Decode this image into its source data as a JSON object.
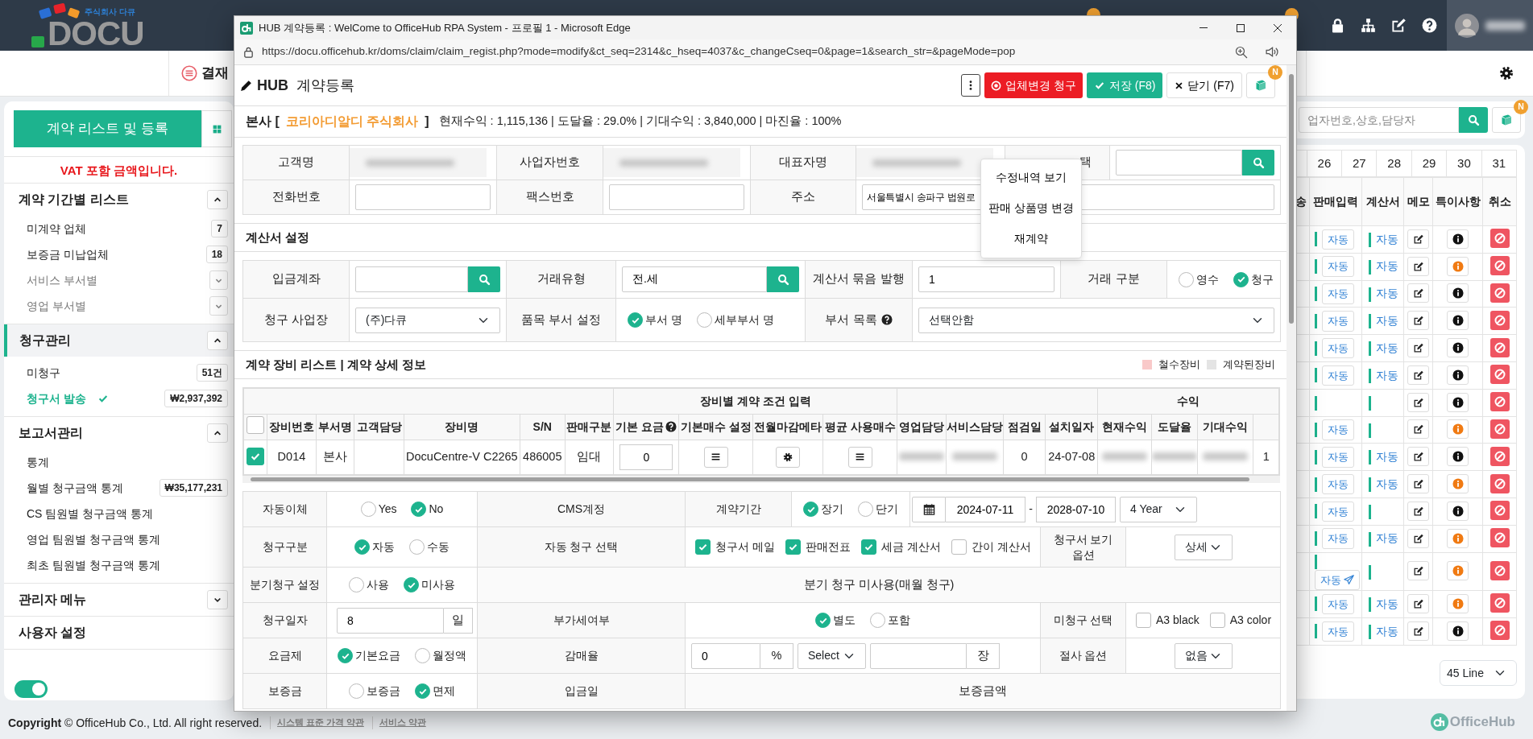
{
  "header": {
    "logo_tagline": "주식회사 다큐",
    "logo_text": "DOCU"
  },
  "subnav": {
    "item": "결재"
  },
  "sidebar": {
    "primary_button": "계약 리스트 및 등록",
    "notice": "VAT 포함 금액입니다.",
    "sections": [
      {
        "title": "계약 기간별 리스트",
        "kind": "collapsible",
        "expanded": true,
        "selected": false,
        "items": [
          {
            "label": "미계약 업체",
            "kind": "count",
            "badge": "7",
            "selected": false
          },
          {
            "label": "보증금 미납업체",
            "kind": "count",
            "badge": "18",
            "selected": false
          },
          {
            "label": "서비스 부서별",
            "kind": "submenu",
            "expanded": false,
            "selected": false
          },
          {
            "label": "영업 부서별",
            "kind": "submenu",
            "expanded": false,
            "selected": false
          }
        ]
      },
      {
        "title": "청구관리",
        "kind": "collapsible",
        "expanded": true,
        "selected": true,
        "items": [
          {
            "label": "미청구",
            "kind": "count",
            "badge": "51건",
            "selected": false
          },
          {
            "label": "청구서 발송",
            "kind": "count",
            "badge": "₩2,937,392",
            "selected": true
          }
        ]
      },
      {
        "title": "보고서관리",
        "kind": "collapsible",
        "expanded": true,
        "selected": false,
        "items": [
          {
            "label": "통계",
            "kind": "link",
            "selected": false
          },
          {
            "label": "월별 청구금액 통계",
            "kind": "count",
            "badge": "₩35,177,231",
            "selected": false
          },
          {
            "label": "CS 팀원별 청구금액 통계",
            "kind": "link",
            "selected": false
          },
          {
            "label": "영업 팀원별 청구금액 통계",
            "kind": "link",
            "selected": false
          },
          {
            "label": "최초 팀원별 청구금액 통계",
            "kind": "link",
            "selected": false
          }
        ]
      },
      {
        "title": "관리자 메뉴",
        "kind": "collapsible",
        "expanded": false,
        "selected": false
      },
      {
        "title": "사용자 설정",
        "kind": "link",
        "selected": false
      }
    ],
    "toggle_on": true
  },
  "list_panel": {
    "search_placeholder": "업자번호,상호,담당자",
    "manual_badge": "N",
    "dates": [
      "26",
      "27",
      "28",
      "29",
      "30",
      "31"
    ],
    "columns": [
      "송",
      "판매입력",
      "계산서",
      "메모",
      "특이사항",
      "취소"
    ],
    "rows": [
      {
        "sales": "자동",
        "sales_sent": false,
        "invoice": "자동",
        "flagged": false
      },
      {
        "sales": "자동",
        "sales_sent": false,
        "invoice": "자동",
        "flagged": true
      },
      {
        "sales": "자동",
        "sales_sent": false,
        "invoice": "자동",
        "flagged": false
      },
      {
        "sales": "자동",
        "sales_sent": false,
        "invoice": "자동",
        "flagged": false
      },
      {
        "sales": "자동",
        "sales_sent": false,
        "invoice": "자동",
        "flagged": false
      },
      {
        "sales": "자동",
        "sales_sent": false,
        "invoice": "자동",
        "flagged": false
      },
      {
        "flagged": false
      },
      {
        "sales": "자동",
        "sales_sent": false,
        "flagged": true
      },
      {
        "sales": "자동",
        "sales_sent": false,
        "invoice": "자동",
        "flagged": false
      },
      {
        "sales": "자동",
        "sales_sent": false,
        "invoice": "자동",
        "flagged": true
      },
      {
        "sales": "자동",
        "sales_sent": false,
        "flagged": false
      },
      {
        "sales": "자동",
        "sales_sent": false,
        "invoice": "자동",
        "flagged": true
      },
      {
        "sales": "자동",
        "sales_sent": true,
        "flagged": true
      },
      {
        "sales": "자동",
        "sales_sent": false,
        "invoice": "자동",
        "flagged": true
      },
      {
        "sales": "자동",
        "sales_sent": false,
        "invoice": "자동",
        "flagged": false
      }
    ],
    "page_size": "45 Line"
  },
  "footer": {
    "copyright": "**Copyright** © OfficeHub Co., Ltd. All right reserved.",
    "links": [
      "시스템 표준 가격 약관",
      "서비스 약관"
    ],
    "brand": "OfficeHub"
  },
  "popup": {
    "title": "HUB 계약등록 : WelCome to OfficeHub RPA System - 프로필 1 - Microsoft Edge",
    "url": "https://docu.officehub.kr/doms/claim/claim_regist.php?mode=modify&ct_seq=2314&c_hseq=4037&c_changeCseq=0&page=1&search_str=&pageMode=pop",
    "brand": "HUB",
    "heading": "계약등록",
    "toolbar": [
      {
        "kind": "more"
      },
      {
        "kind": "danger",
        "label": "업체변경 청구"
      },
      {
        "kind": "save",
        "label": "저장 (F8)"
      },
      {
        "kind": "close",
        "label": "닫기 (F7)"
      },
      {
        "kind": "manual",
        "badge": "N"
      }
    ],
    "more_menu": {
      "open": true,
      "items": [
        "수정내역 보기",
        "판매 상품명 변경",
        "재계약"
      ]
    },
    "company": {
      "branch": "본사 [",
      "name": "코리아디알디 주식회사",
      "close": "]",
      "stats": "현재수익 : 1,115,136 | 도달율 : 29.0% | 기대수익 : 3,840,000 | 마진율 : 100%"
    },
    "customer_rows": [
      [
        {
          "label": "고객명",
          "kind": "redacted"
        },
        {
          "label": "사업자번호",
          "kind": "redacted"
        },
        {
          "label": "대표자명",
          "kind": "redacted"
        },
        {
          "label": "택",
          "kind": "search"
        }
      ],
      [
        {
          "label": "전화번호",
          "kind": "input"
        },
        {
          "label": "팩스번호",
          "kind": "input"
        },
        {
          "label": "주소",
          "kind": "input",
          "value": "서울특별시 송파구 법원로"
        }
      ]
    ],
    "invoice_title": "계산서 설정",
    "invoice_rows": [
      [
        {
          "label": "입금계좌",
          "kind": "search"
        },
        {
          "label": "거래유형",
          "kind": "search",
          "value": "전.세"
        },
        {
          "label": "계산서 묶음 발행",
          "kind": "input",
          "value": "1"
        },
        {
          "label": "거래 구분",
          "kind": "radio",
          "options": [
            {
              "label": "영수",
              "selected": false
            },
            {
              "label": "청구",
              "selected": true
            }
          ]
        }
      ],
      [
        {
          "label": "청구 사업장",
          "kind": "select",
          "value": "(주)다큐"
        },
        {
          "label": "품목 부서 설정",
          "kind": "radio",
          "options": [
            {
              "label": "부서 명",
              "selected": true
            },
            {
              "label": "세부부서 명",
              "selected": false
            }
          ]
        },
        {
          "label": "부서 목록",
          "kind": "select",
          "help": true,
          "value": "선택안함"
        }
      ]
    ],
    "equipment_title": "계약 장비 리스트 | 계약 상세 정보",
    "legend": [
      {
        "label": "철수장비",
        "color": "#f9c9c9"
      },
      {
        "label": "계약된장비",
        "color": "#e4e4e4"
      }
    ],
    "column_groups": [
      {
        "label": "장비별 계약 조건 입력"
      },
      {
        "label": "수익"
      }
    ],
    "columns": [
      {
        "kind": "checkbox",
        "checked": false
      },
      {
        "label": "장비번호"
      },
      {
        "label": "부서명"
      },
      {
        "label": "고객담당"
      },
      {
        "label": "장비명"
      },
      {
        "label": "S/N"
      },
      {
        "label": "판매구분"
      },
      {
        "label": "기본 요금",
        "help": true
      },
      {
        "label": "기본매수 설정"
      },
      {
        "label": "전월마감메타"
      },
      {
        "label": "평균 사용매수"
      },
      {
        "label": "영업담당"
      },
      {
        "label": "서비스담당"
      },
      {
        "label": "점검일"
      },
      {
        "label": "설치일자"
      },
      {
        "label": "현재수익"
      },
      {
        "label": "도달율"
      },
      {
        "label": "기대수익"
      },
      {}
    ],
    "equipment_rows": [
      {
        "checked": true,
        "cells": [
          {
            "kind": "text",
            "value": "D014"
          },
          {
            "kind": "text",
            "value": "본사"
          },
          {
            "kind": "empty"
          },
          {
            "kind": "text",
            "value": "DocuCentre-V C2265"
          },
          {
            "kind": "text",
            "value": "486005"
          },
          {
            "kind": "text",
            "value": "임대"
          },
          {
            "kind": "input",
            "value": "0"
          },
          {
            "kind": "list_button"
          },
          {
            "kind": "gear_button"
          },
          {
            "kind": "list_button"
          },
          {
            "kind": "redacted"
          },
          {
            "kind": "redacted"
          },
          {
            "kind": "text",
            "value": "0"
          },
          {
            "kind": "text",
            "value": "24-07-08"
          },
          {
            "kind": "redacted"
          },
          {
            "kind": "redacted"
          },
          {
            "kind": "redacted"
          },
          {
            "kind": "text",
            "value": "1"
          }
        ]
      }
    ],
    "detail_rows": [
      [
        {
          "kind": "label",
          "text": "자동이체"
        },
        {
          "kind": "radio",
          "options": [
            {
              "label": "Yes",
              "selected": false
            },
            {
              "label": "No",
              "selected": true
            }
          ]
        },
        {
          "kind": "label",
          "text": "CMS계정"
        },
        {
          "kind": "label",
          "text": "계약기간"
        },
        {
          "kind": "radio",
          "options": [
            {
              "label": "장기",
              "selected": true
            },
            {
              "label": "단기",
              "selected": false
            }
          ]
        },
        {
          "kind": "date_range",
          "start": "2024-07-11",
          "separator": "-",
          "end": "2028-07-10",
          "period": "4 Year"
        }
      ],
      [
        {
          "kind": "label",
          "text": "청구구분"
        },
        {
          "kind": "radio",
          "options": [
            {
              "label": "자동",
              "selected": true
            },
            {
              "label": "수동",
              "selected": false
            }
          ]
        },
        {
          "kind": "label",
          "text": "자동 청구 선택"
        },
        {
          "kind": "checks",
          "options": [
            {
              "label": "청구서 메일",
              "checked": true
            },
            {
              "label": "판매전표",
              "checked": true
            },
            {
              "label": "세금 계산서",
              "checked": true
            },
            {
              "label": "간이 계산서",
              "checked": false
            }
          ]
        },
        {
          "kind": "label",
          "text": "청구서 보기 옵션"
        },
        {
          "kind": "select",
          "value": "상세"
        }
      ],
      [
        {
          "kind": "label",
          "text": "분기청구 설정"
        },
        {
          "kind": "radio",
          "options": [
            {
              "label": "사용",
              "selected": false
            },
            {
              "label": "미사용",
              "selected": true
            }
          ]
        },
        {
          "kind": "note",
          "text": "분기 청구 미사용(매월 청구)"
        }
      ],
      [
        {
          "kind": "label",
          "text": "청구일자"
        },
        {
          "kind": "input_addon",
          "value": "8",
          "addon": "일"
        },
        {
          "kind": "label",
          "text": "부가세여부"
        },
        {
          "kind": "radio",
          "options": [
            {
              "label": "별도",
              "selected": true
            },
            {
              "label": "포함",
              "selected": false
            }
          ]
        },
        {
          "kind": "label",
          "text": "미청구 선택"
        },
        {
          "kind": "checks",
          "options": [
            {
              "label": "A3 black",
              "checked": false
            },
            {
              "label": "A3 color",
              "checked": false
            }
          ]
        }
      ],
      [
        {
          "kind": "label",
          "text": "요금제"
        },
        {
          "kind": "radio",
          "options": [
            {
              "label": "기본요금",
              "selected": true
            },
            {
              "label": "월정액",
              "selected": false
            }
          ]
        },
        {
          "kind": "label",
          "text": "감매율"
        },
        {
          "kind": "rate",
          "value": "0",
          "unit": "%",
          "select": "Select",
          "unit2": "장"
        },
        {
          "kind": "label",
          "text": "절사 옵션"
        },
        {
          "kind": "select",
          "value": "없음"
        }
      ],
      [
        {
          "kind": "label",
          "text": "보증금"
        },
        {
          "kind": "radio",
          "options": [
            {
              "label": "보증금",
              "selected": false
            },
            {
              "label": "면제",
              "selected": true
            }
          ]
        },
        {
          "kind": "label",
          "text": "입금일"
        },
        {
          "kind": "note",
          "text": "보증금액"
        }
      ]
    ]
  }
}
